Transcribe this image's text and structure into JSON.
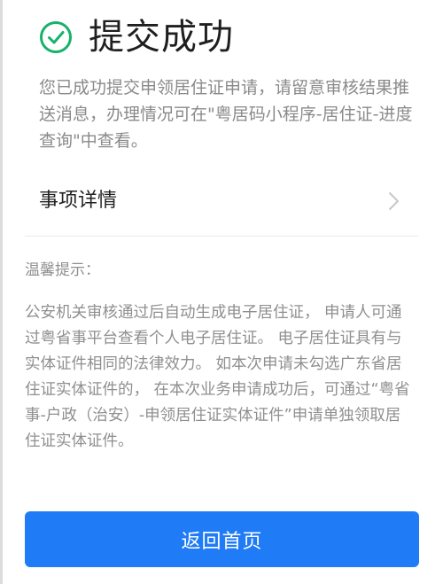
{
  "page": {
    "status_icon": "check-circle-icon",
    "accent_color": "#17b26a",
    "title": "提交成功",
    "description": "您已成功提交申领居住证申请，请留意审核结果推送消息，办理情况可在\"粤居码小程序-居住证-进度查询\"中查看。"
  },
  "detail_row": {
    "label": "事项详情",
    "icon": "chevron-right-icon"
  },
  "tips": {
    "title": "温馨提示：",
    "body": "公安机关审核通过后自动生成电子居住证， 申请人可通过粤省事平台查看个人电子居住证。 电子居住证具有与实体证件相同的法律效力。 如本次申请未勾选广东省居住证实体证件的， 在本次业务申请成功后，可通过“粤省事-户政（治安）-申领居住证实体证件”申请单独领取居住证实体证件。"
  },
  "footer": {
    "button_label": "返回首页",
    "button_color": "#1f7bf6"
  }
}
